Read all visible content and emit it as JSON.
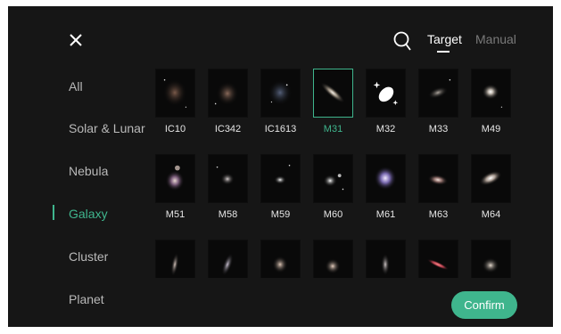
{
  "header": {
    "close_icon": "close-icon",
    "search_icon": "search-icon",
    "tabs": [
      {
        "label": "Target",
        "active": true
      },
      {
        "label": "Manual",
        "active": false
      }
    ]
  },
  "sidebar": {
    "items": [
      {
        "label": "All",
        "active": false
      },
      {
        "label": "Solar & Lunar",
        "active": false
      },
      {
        "label": "Nebula",
        "active": false
      },
      {
        "label": "Galaxy",
        "active": true
      },
      {
        "label": "Cluster",
        "active": false
      },
      {
        "label": "Planet",
        "active": false
      }
    ]
  },
  "grid": {
    "selected": "M31",
    "rows": [
      [
        {
          "label": "IC10",
          "kind": "galaxy-image"
        },
        {
          "label": "IC342",
          "kind": "galaxy-image"
        },
        {
          "label": "IC1613",
          "kind": "galaxy-image"
        },
        {
          "label": "M31",
          "kind": "galaxy-image"
        },
        {
          "label": "M32",
          "kind": "galaxy-icon"
        },
        {
          "label": "M33",
          "kind": "galaxy-image"
        },
        {
          "label": "M49",
          "kind": "galaxy-image"
        }
      ],
      [
        {
          "label": "M51",
          "kind": "galaxy-image"
        },
        {
          "label": "M58",
          "kind": "galaxy-image"
        },
        {
          "label": "M59",
          "kind": "galaxy-image"
        },
        {
          "label": "M60",
          "kind": "galaxy-image"
        },
        {
          "label": "M61",
          "kind": "galaxy-image"
        },
        {
          "label": "M63",
          "kind": "galaxy-image"
        },
        {
          "label": "M64",
          "kind": "galaxy-image"
        }
      ],
      [
        {
          "label": "",
          "kind": "galaxy-image"
        },
        {
          "label": "",
          "kind": "galaxy-image"
        },
        {
          "label": "",
          "kind": "galaxy-image"
        },
        {
          "label": "",
          "kind": "galaxy-image"
        },
        {
          "label": "",
          "kind": "galaxy-image"
        },
        {
          "label": "",
          "kind": "galaxy-image"
        },
        {
          "label": "",
          "kind": "galaxy-image"
        }
      ]
    ]
  },
  "footer": {
    "confirm_label": "Confirm"
  },
  "colors": {
    "accent": "#3fb58d",
    "background": "#161616",
    "text_primary": "#ffffff",
    "text_secondary": "#b9b9b9"
  }
}
